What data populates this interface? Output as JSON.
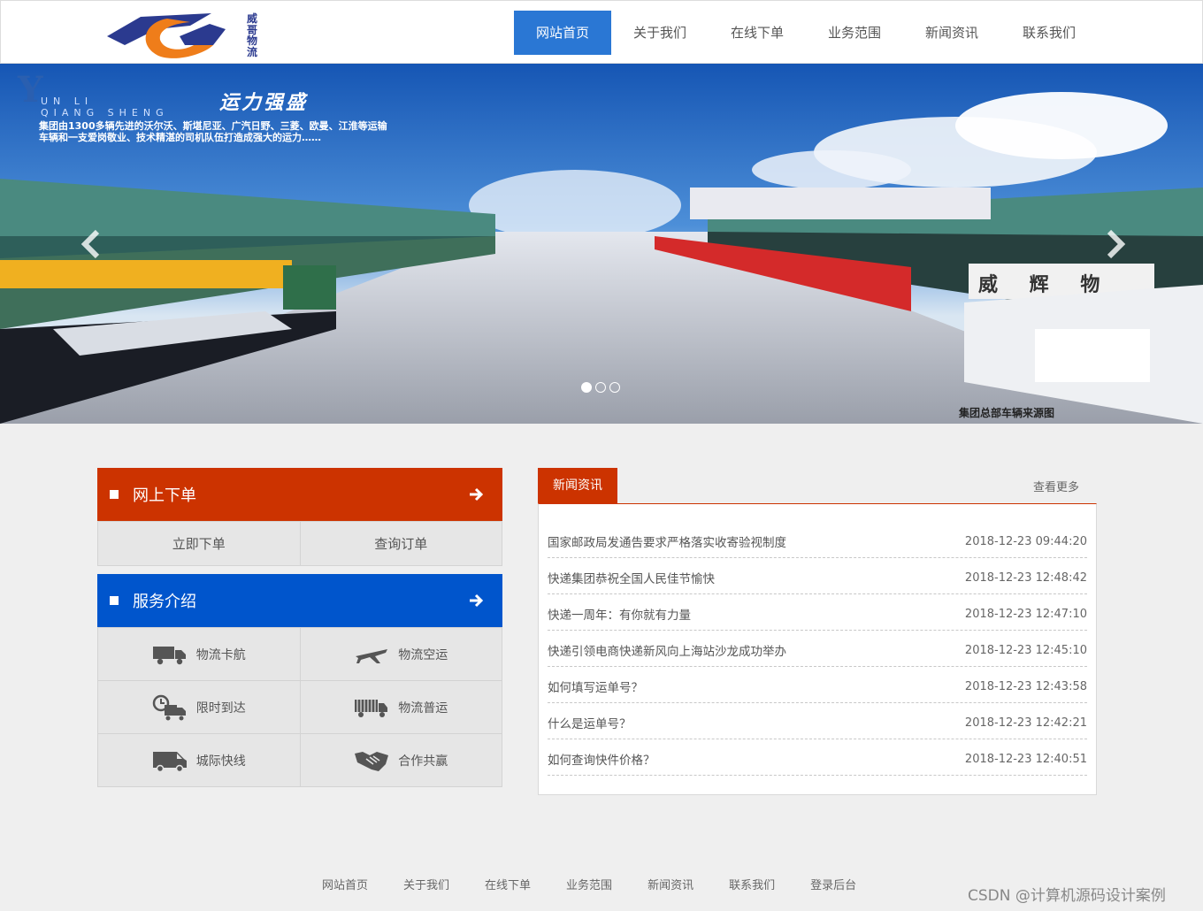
{
  "header": {
    "logo_text": "威哥物流",
    "nav": [
      {
        "label": "网站首页",
        "active": true
      },
      {
        "label": "关于我们"
      },
      {
        "label": "在线下单"
      },
      {
        "label": "业务范围"
      },
      {
        "label": "新闻资讯"
      },
      {
        "label": "联系我们"
      }
    ]
  },
  "banner": {
    "brand_letters": "Y",
    "brand_sub_1": "UN LI",
    "brand_sub_2": "QIANG SHENG",
    "slogan": "运力强盛",
    "description": "集团由1300多辆先进的沃尔沃、斯堪尼亚、广汽日野、三菱、欧曼、江淮等运输车辆和一支爱岗敬业、技术精湛的司机队伍打造成强大的运力……",
    "truck_sign": "威 辉 物",
    "caption": "集团总部车辆来源图",
    "active_slide": 1
  },
  "order_panel": {
    "title": "网上下单",
    "actions": [
      "立即下单",
      "查询订单"
    ]
  },
  "service_panel": {
    "title": "服务介绍",
    "items": [
      {
        "label": "物流卡航",
        "icon": "truck-icon"
      },
      {
        "label": "物流空运",
        "icon": "airplane-icon"
      },
      {
        "label": "限时到达",
        "icon": "clock-truck-icon"
      },
      {
        "label": "物流普运",
        "icon": "cargo-truck-icon"
      },
      {
        "label": "城际快线",
        "icon": "van-icon"
      },
      {
        "label": "合作共赢",
        "icon": "handshake-icon"
      }
    ]
  },
  "news": {
    "tab": "新闻资讯",
    "more": "查看更多",
    "items": [
      {
        "title": "国家邮政局发通告要求严格落实收寄验视制度",
        "date": "2018-12-23 09:44:20"
      },
      {
        "title": "快递集团恭祝全国人民佳节愉快",
        "date": "2018-12-23 12:48:42"
      },
      {
        "title": "快递一周年：有你就有力量",
        "date": "2018-12-23 12:47:10"
      },
      {
        "title": "快递引领电商快递新风向上海站沙龙成功举办",
        "date": "2018-12-23 12:45:10"
      },
      {
        "title": "如何填写运单号？",
        "date": "2018-12-23 12:43:58"
      },
      {
        "title": "什么是运单号？",
        "date": "2018-12-23 12:42:21"
      },
      {
        "title": "如何查询快件价格？",
        "date": "2018-12-23 12:40:51"
      }
    ]
  },
  "footer": {
    "links": [
      "网站首页",
      "关于我们",
      "在线下单",
      "业务范围",
      "新闻资讯",
      "联系我们",
      "登录后台"
    ],
    "watermark": "CSDN @计算机源码设计案例"
  },
  "colors": {
    "nav_active": "#2a77d4",
    "order_red": "#cc3300",
    "service_blue": "#0055cc"
  }
}
